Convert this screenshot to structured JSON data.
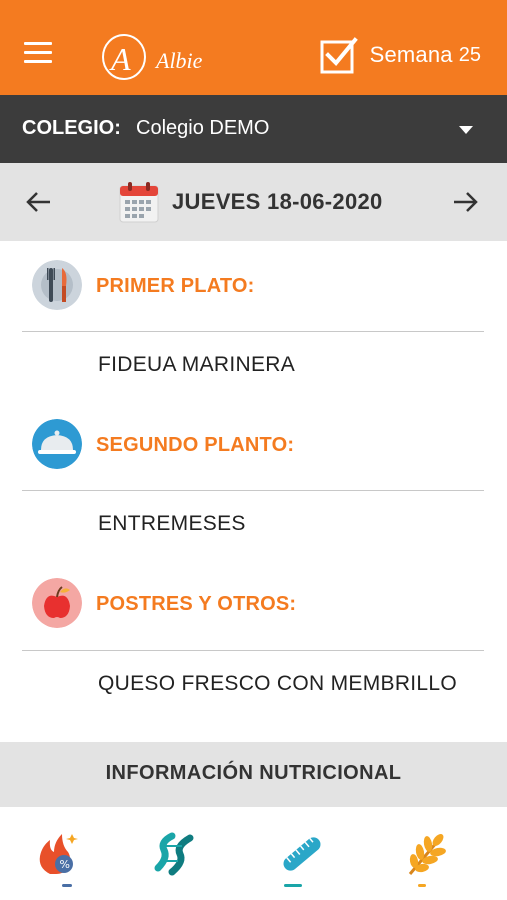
{
  "header": {
    "brand_mark": "A",
    "brand_name": "Albie",
    "week_label": "Semana",
    "week_number": "25",
    "bg_color": "#f47b20"
  },
  "school": {
    "label": "COLEGIO:",
    "value": "Colegio DEMO"
  },
  "date_nav": {
    "date": "JUEVES 18-06-2020"
  },
  "menu": {
    "sections": [
      {
        "title": "PRIMER PLATO:",
        "dish": "FIDEUA MARINERA",
        "icon": "cutlery-icon"
      },
      {
        "title": "SEGUNDO PLANTO:",
        "dish": "ENTREMESES",
        "icon": "cloche-icon"
      },
      {
        "title": "POSTRES Y OTROS:",
        "dish": "QUESO FRESCO CON MEMBRILLO",
        "icon": "apple-icon"
      }
    ]
  },
  "nutrition": {
    "title": "INFORMACIÓN NUTRICIONAL",
    "tabs": [
      {
        "icon": "calories-icon",
        "color": "#e8502a"
      },
      {
        "icon": "protein-helix-icon",
        "color": "#1aa5a8"
      },
      {
        "icon": "measure-icon",
        "color": "#2aa7c8"
      },
      {
        "icon": "wheat-icon",
        "color": "#f5a623"
      }
    ]
  }
}
